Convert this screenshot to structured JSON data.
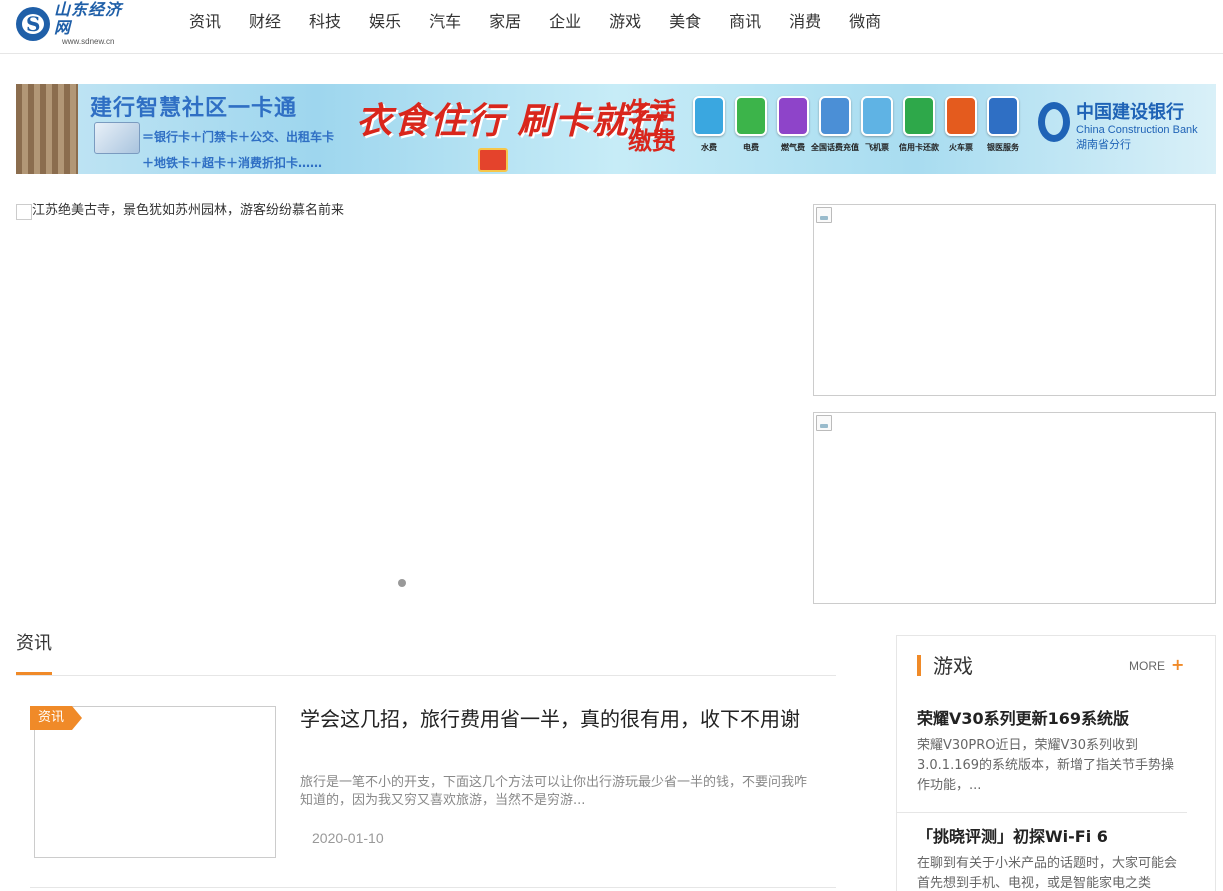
{
  "header": {
    "logo_cn": "山东经济网",
    "logo_url": "www.sdnew.cn",
    "nav": [
      "资讯",
      "财经",
      "科技",
      "娱乐",
      "汽车",
      "家居",
      "企业",
      "游戏",
      "美食",
      "商讯",
      "消费",
      "微商"
    ]
  },
  "banner": {
    "title": "建行智慧社区一卡通",
    "line1": "＝银行卡＋门禁卡＋公交、出租车卡",
    "line2": "＋地铁卡＋超卡＋消费折扣卡……",
    "slogan": "衣食住行 刷卡就行",
    "pay_label": "生活缴费",
    "icons": [
      {
        "label": "水费",
        "color": "#3aa7e0"
      },
      {
        "label": "电费",
        "color": "#3cb44a"
      },
      {
        "label": "燃气费",
        "color": "#8e44c9"
      },
      {
        "label": "全国话费充值",
        "color": "#4b8fd6"
      },
      {
        "label": "飞机票",
        "color": "#5fb3e4"
      },
      {
        "label": "信用卡还款",
        "color": "#2ea84a"
      },
      {
        "label": "火车票",
        "color": "#e45b1e"
      },
      {
        "label": "银医服务",
        "color": "#2f6fc4"
      }
    ],
    "bank_cn": "中国建设银行",
    "bank_en": "China Construction Bank",
    "bank_branch": "湖南省分行"
  },
  "slider": {
    "caption": "江苏绝美古寺，景色犹如苏州园林，游客纷纷慕名前来"
  },
  "section": {
    "title": "资讯"
  },
  "article": {
    "tag": "资讯",
    "title": "学会这几招，旅行费用省一半，真的很有用，收下不用谢",
    "desc": "旅行是一笔不小的开支，下面这几个方法可以让你出行游玩最少省一半的钱，不要问我咋知道的，因为我又穷又喜欢旅游，当然不是穷游...",
    "date": "2020-01-10"
  },
  "sidebar": {
    "title": "游戏",
    "more": "MORE",
    "plus": "+",
    "items": [
      {
        "title": "荣耀V30系列更新169系统版",
        "desc": "荣耀V30PRO近日，荣耀V30系列收到3.0.1.169的系统版本，新增了指关节手势操作功能，..."
      },
      {
        "title": "「挑晓评测」初探Wi-Fi 6",
        "desc": "在聊到有关于小米产品的话题时，大家可能会首先想到手机、电视，或是智能家电之类"
      }
    ]
  },
  "colors": {
    "accent": "#f08a28",
    "brand": "#1f5fa8"
  }
}
